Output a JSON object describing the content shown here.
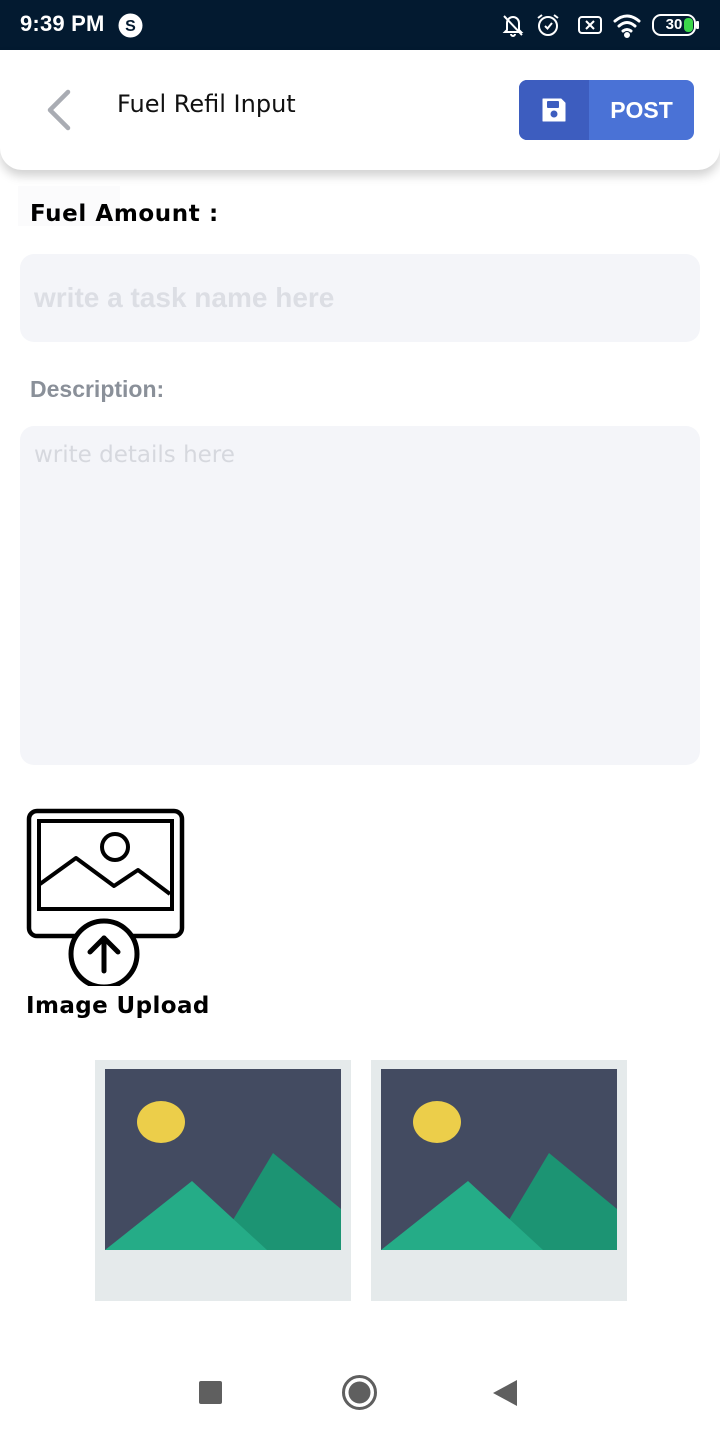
{
  "status_bar": {
    "time": "9:39 PM",
    "battery": "30",
    "icons": [
      "skype-icon",
      "bell-off-icon",
      "alarm-icon",
      "sim-off-icon",
      "wifi-icon",
      "battery-icon"
    ]
  },
  "header": {
    "title": "Fuel Refil Input",
    "post_label": "POST",
    "post_icon": "floppy-disk-icon",
    "accent_color": "#4a72d6",
    "accent_dark": "#3d5dbf"
  },
  "form": {
    "fuel_label": "Fuel Amount :",
    "fuel_placeholder": "write a task name here",
    "description_label": "Description:",
    "description_placeholder": "write details here",
    "upload_label": "Image Upload",
    "upload_icon": "image-upload-icon"
  },
  "thumbnails": [
    {
      "icon": "image-placeholder-icon"
    },
    {
      "icon": "image-placeholder-icon"
    }
  ],
  "navigation": [
    "recents-square-button",
    "home-circle-button",
    "back-triangle-button"
  ]
}
